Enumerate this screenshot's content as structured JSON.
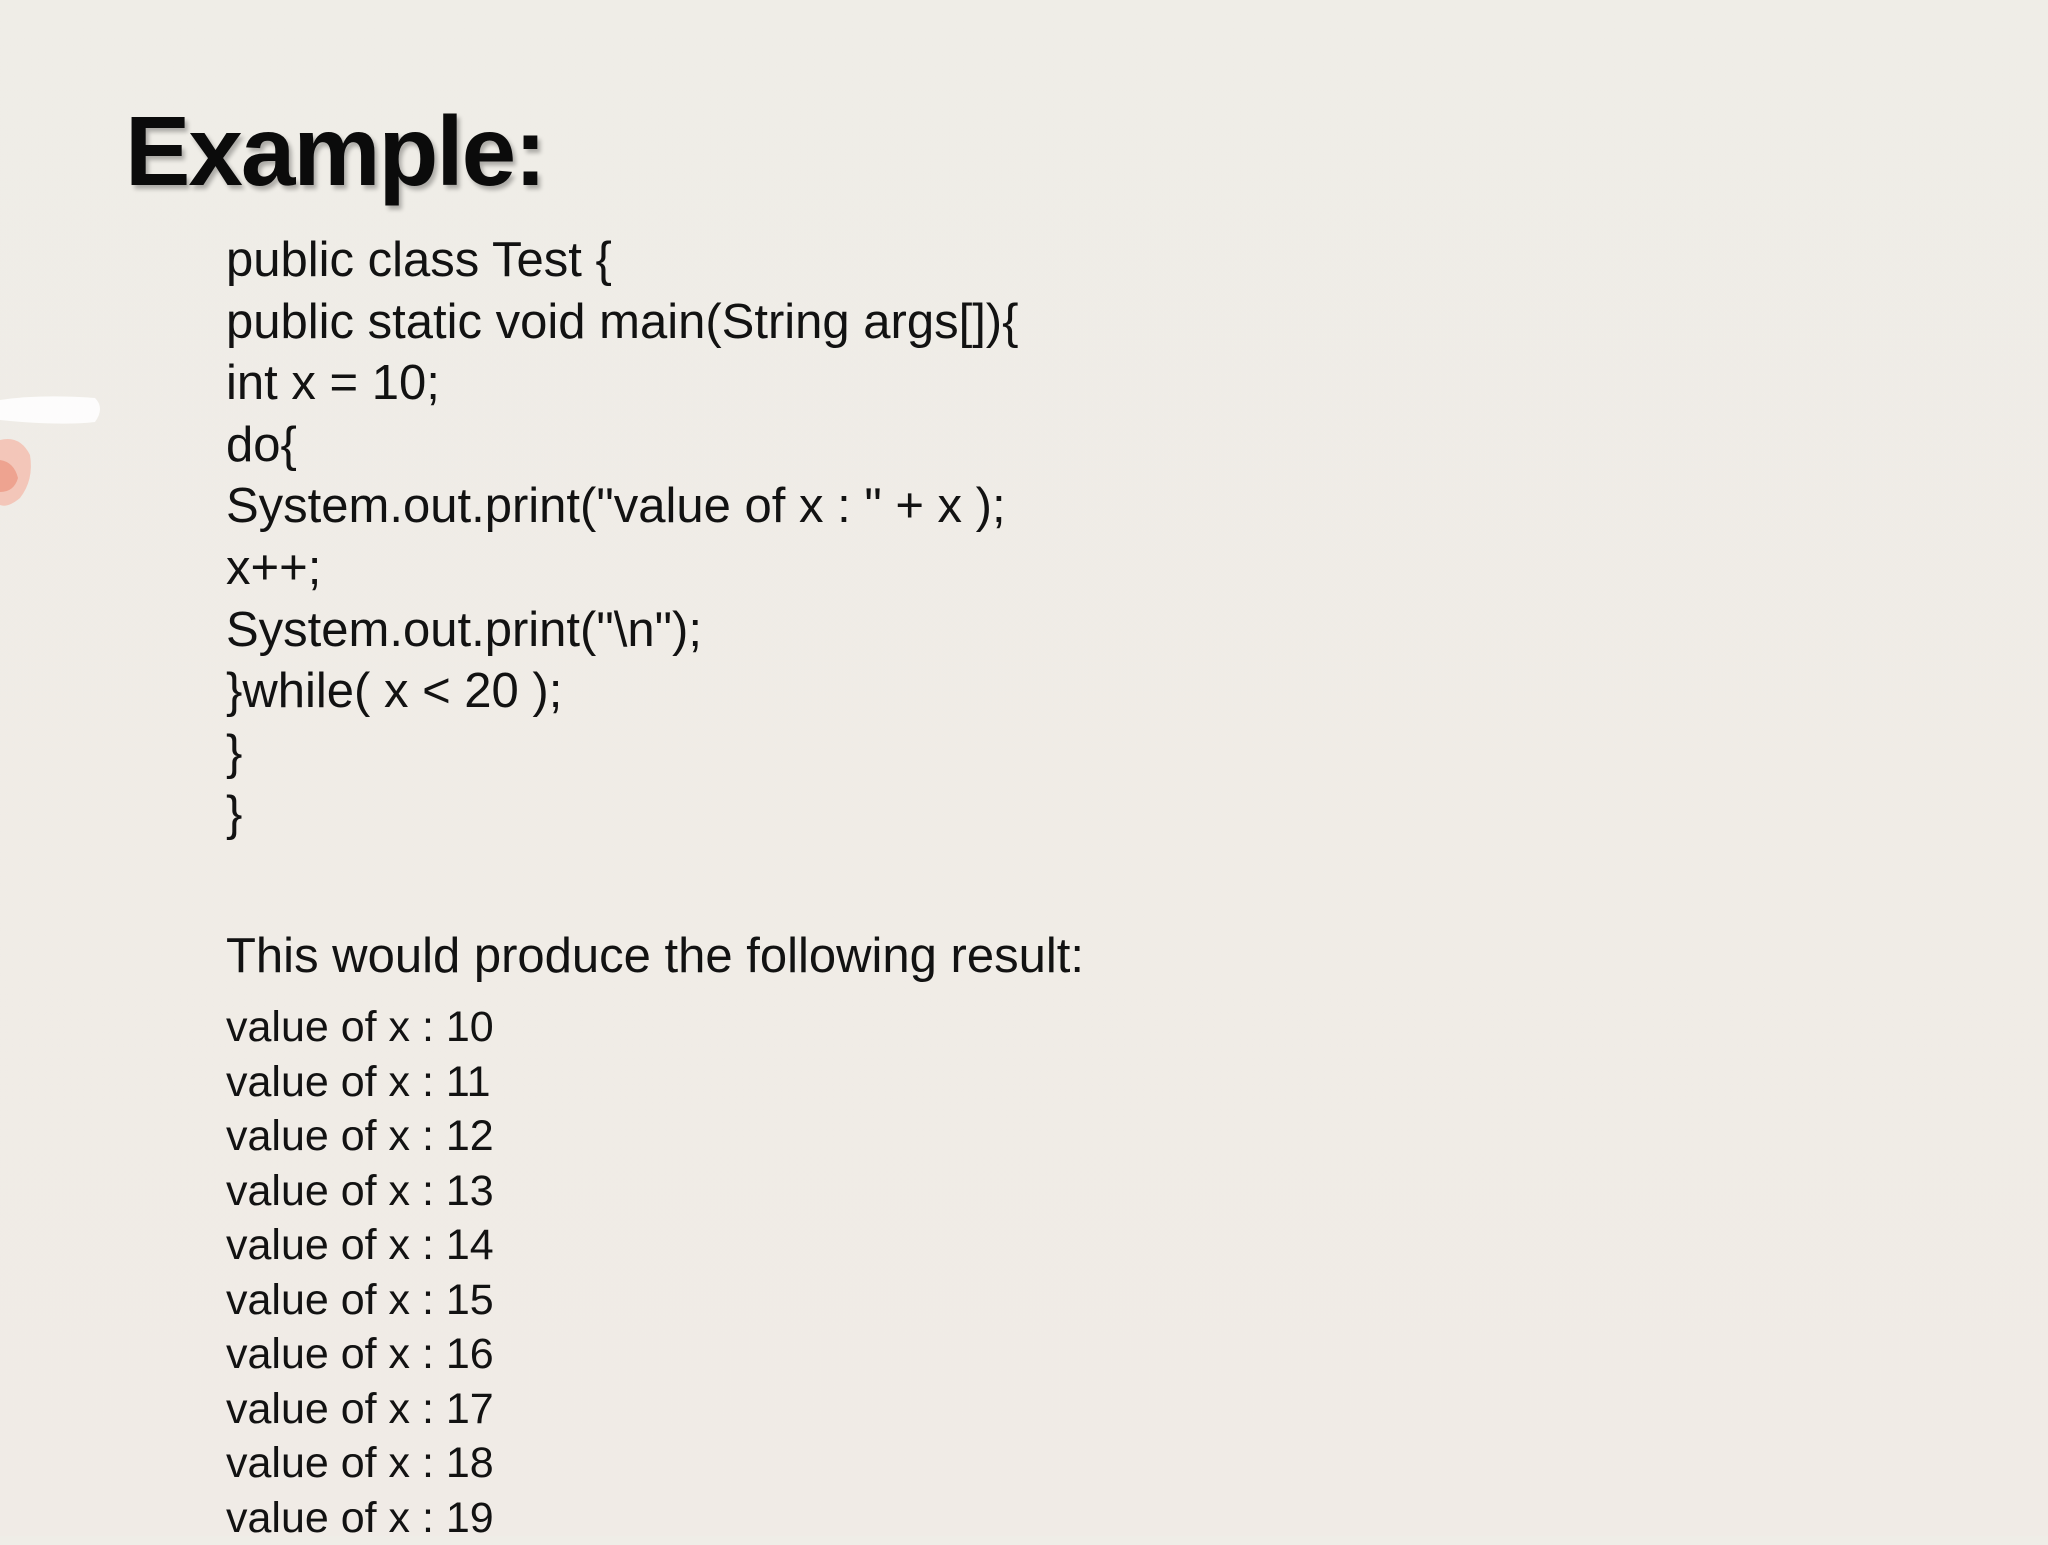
{
  "slide": {
    "title": "Example:",
    "code_lines": [
      "public class Test {",
      "public static void main(String args[]){",
      "int x = 10;",
      "do{",
      "System.out.print(\"value of x : \" + x );",
      "x++;",
      "System.out.print(\"\\n\");",
      "}while( x < 20 );",
      "}",
      "}"
    ],
    "result_label": "This would produce the following result:",
    "output_lines": [
      "value of x : 10",
      "value of x : 11",
      "value of x : 12",
      "value of x : 13",
      "value of x : 14",
      "value of x : 15",
      "value of x : 16",
      "value of x : 17",
      "value of x : 18",
      "value of x : 19"
    ]
  }
}
